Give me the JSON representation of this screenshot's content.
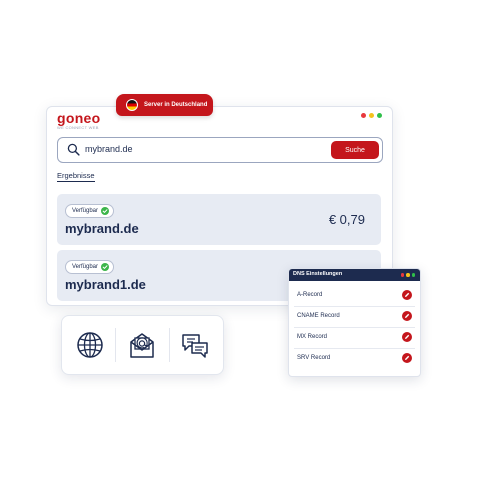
{
  "brand": {
    "logo": "goneo",
    "tagline": "WE CONNECT WEB"
  },
  "badge": {
    "text": "Server in Deutschland",
    "flag_icon": "germany-flag-icon"
  },
  "window_controls": {
    "colors": [
      "#e8383d",
      "#f4c21c",
      "#2fbf4a"
    ]
  },
  "search": {
    "value": "mybrand.de",
    "button_label": "Suche",
    "icon": "search-icon"
  },
  "results": {
    "label": "Ergebnisse",
    "items": [
      {
        "status": "Verfügbar",
        "domain": "mybrand.de",
        "price": "€ 0,79"
      },
      {
        "status": "Verfügbar",
        "domain": "mybrand1.de",
        "price": ""
      }
    ]
  },
  "services": [
    {
      "icon": "globe-icon"
    },
    {
      "icon": "email-at-icon"
    },
    {
      "icon": "chat-bubbles-icon"
    }
  ],
  "dns": {
    "title": "DNS Einstellungen",
    "records": [
      {
        "label": "A-Record"
      },
      {
        "label": "CNAME Record"
      },
      {
        "label": "MX Record"
      },
      {
        "label": "SRV Record"
      }
    ]
  },
  "colors": {
    "accent": "#c4161c",
    "navy": "#1d2b4f",
    "success": "#3cb54a",
    "card": "#e7ebf3"
  }
}
